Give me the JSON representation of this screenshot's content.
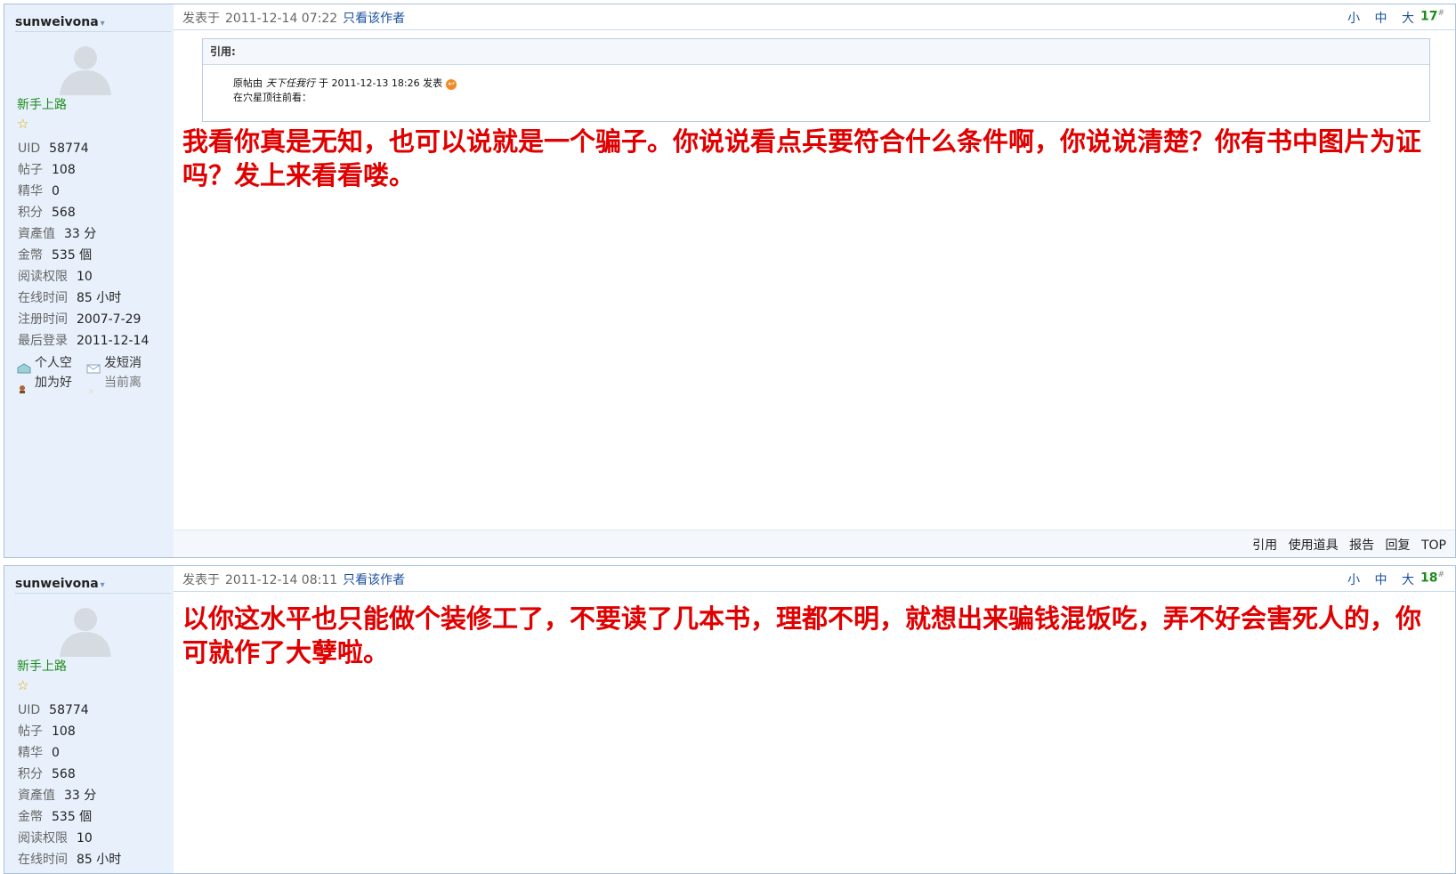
{
  "posts": [
    {
      "author": {
        "name": "sunweivona",
        "rank": "新手上路",
        "star_icon": "star-icon",
        "stats": [
          {
            "k": "UID",
            "v": "58774"
          },
          {
            "k": "帖子",
            "v": "108"
          },
          {
            "k": "精华",
            "v": "0"
          },
          {
            "k": "积分",
            "v": "568"
          },
          {
            "k": "資產值",
            "v": "33 分"
          },
          {
            "k": "金幣",
            "v": "535 個"
          },
          {
            "k": "阅读权限",
            "v": "10"
          },
          {
            "k": "在线时间",
            "v": "85 小时"
          },
          {
            "k": "注册时间",
            "v": "2007-7-29"
          },
          {
            "k": "最后登录",
            "v": "2011-12-14"
          }
        ],
        "links": [
          "个人空",
          "发短消",
          "加为好",
          "当前离"
        ]
      },
      "header": {
        "posted_label": "发表于",
        "datetime": "2011-12-14 07:22",
        "only_author": "只看该作者",
        "font_sizes": "小 中 大",
        "floor": "17",
        "floor_mark": "#"
      },
      "quote": {
        "title": "引用:",
        "prefix": "原帖由",
        "orig_author": "天下任我行",
        "at": "于",
        "orig_datetime": "2011-12-13 18:26",
        "posted": "发表",
        "text": "在穴星顶往前看："
      },
      "message": "我看你真是无知，也可以说就是一个骗子。你说说看点兵要符合什么条件啊，你说说清楚？你有书中图片为证吗？发上来看看喽。",
      "footer": [
        "引用",
        "使用道具",
        "报告",
        "回复",
        "TOP"
      ]
    },
    {
      "author": {
        "name": "sunweivona",
        "rank": "新手上路",
        "star_icon": "star-icon",
        "stats": [
          {
            "k": "UID",
            "v": "58774"
          },
          {
            "k": "帖子",
            "v": "108"
          },
          {
            "k": "精华",
            "v": "0"
          },
          {
            "k": "积分",
            "v": "568"
          },
          {
            "k": "資產值",
            "v": "33 分"
          },
          {
            "k": "金幣",
            "v": "535 個"
          },
          {
            "k": "阅读权限",
            "v": "10"
          },
          {
            "k": "在线时间",
            "v": "85 小时"
          }
        ]
      },
      "header": {
        "posted_label": "发表于",
        "datetime": "2011-12-14 08:11",
        "only_author": "只看该作者",
        "font_sizes": "小 中 大",
        "floor": "18",
        "floor_mark": "#"
      },
      "message": "以你这水平也只能做个装修工了，不要读了几本书，理都不明，就想出来骗钱混饭吃，弄不好会害死人的，你可就作了大孽啦。"
    }
  ],
  "colors": {
    "border": "#a9c1d9",
    "sidebar": "#e8f1fb",
    "message": "#e00000",
    "rank": "#1d8c1d",
    "link": "#1a4f9f"
  }
}
